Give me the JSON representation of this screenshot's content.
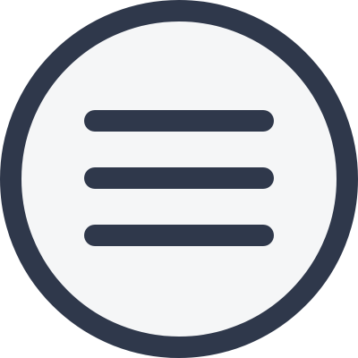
{
  "icon": {
    "name": "hamburger-menu-icon",
    "color": "#2f384b",
    "background": "#f5f6f7"
  }
}
